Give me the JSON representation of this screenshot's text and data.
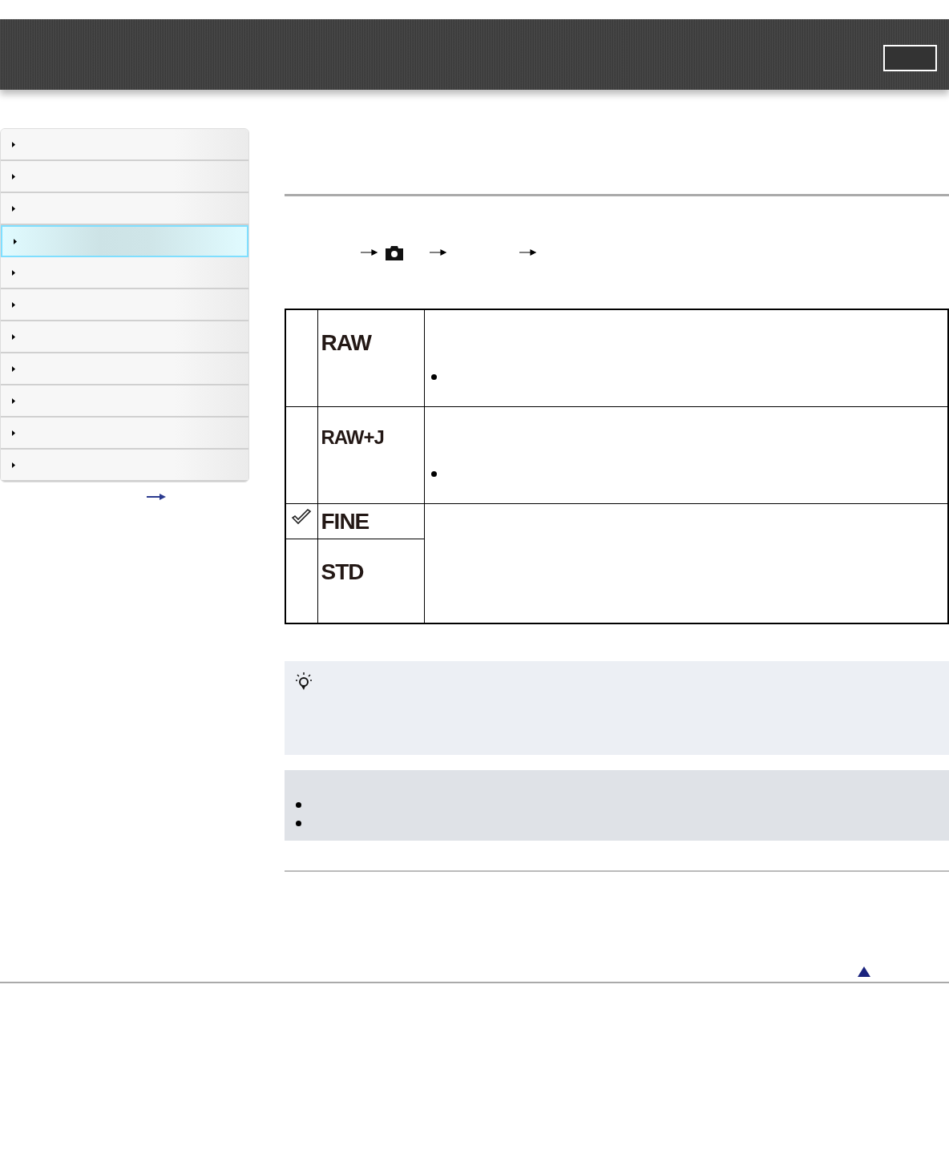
{
  "sidebar": {
    "items": [
      {
        "selected": false
      },
      {
        "selected": false
      },
      {
        "selected": false
      },
      {
        "selected": true
      },
      {
        "selected": false
      },
      {
        "selected": false
      },
      {
        "selected": false
      },
      {
        "selected": false
      },
      {
        "selected": false
      },
      {
        "selected": false
      },
      {
        "selected": false
      }
    ]
  },
  "table": {
    "rows": [
      {
        "label": "RAW",
        "checked": false
      },
      {
        "label": "RAW+J",
        "checked": false
      },
      {
        "label": "FINE",
        "checked": true
      },
      {
        "label": "STD",
        "checked": false
      }
    ]
  }
}
